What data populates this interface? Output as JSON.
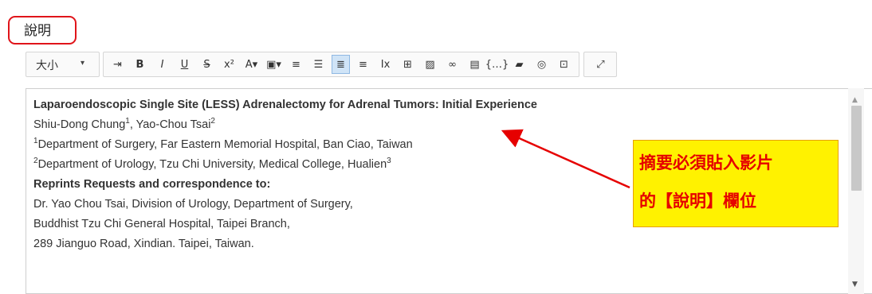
{
  "field": {
    "label": "說明"
  },
  "toolbar": {
    "size_label": "大小",
    "size_caret": "▾",
    "buttons": [
      {
        "name": "indent-icon",
        "glyph": "⇥"
      },
      {
        "name": "bold-icon",
        "glyph": "B"
      },
      {
        "name": "italic-icon",
        "glyph": "I"
      },
      {
        "name": "underline-icon",
        "glyph": "U"
      },
      {
        "name": "strikethrough-icon",
        "glyph": "S"
      },
      {
        "name": "superscript-icon",
        "glyph": "x²"
      },
      {
        "name": "font-color-icon",
        "glyph": "A▾"
      },
      {
        "name": "background-color-icon",
        "glyph": "▣▾"
      },
      {
        "name": "numbered-list-icon",
        "glyph": "≡"
      },
      {
        "name": "bulleted-list-icon",
        "glyph": "☰"
      },
      {
        "name": "align-left-icon",
        "glyph": "≣"
      },
      {
        "name": "align-center-icon",
        "glyph": "≡"
      },
      {
        "name": "remove-format-icon",
        "glyph": "Ix"
      },
      {
        "name": "table-icon",
        "glyph": "⊞"
      },
      {
        "name": "image-icon",
        "glyph": "▨"
      },
      {
        "name": "link-icon",
        "glyph": "∞"
      },
      {
        "name": "media-icon",
        "glyph": "▤"
      },
      {
        "name": "code-icon",
        "glyph": "{…}"
      },
      {
        "name": "folder-icon",
        "glyph": "▰"
      },
      {
        "name": "globe-icon",
        "glyph": "◎"
      },
      {
        "name": "source-icon",
        "glyph": "⊡"
      }
    ],
    "fullscreen_glyph": "⤢"
  },
  "editor": {
    "title": "Laparoendoscopic Single Site (LESS) Adrenalectomy for Adrenal Tumors: Initial Experience",
    "authors": {
      "name1": "Shiu-Dong Chung",
      "sup1": "1",
      "sep": ", ",
      "name2": "Yao-Chou Tsai",
      "sup2": "2"
    },
    "affiliation1": {
      "sup": "1",
      "text": "Department of Surgery, Far Eastern Memorial Hospital, Ban Ciao, Taiwan"
    },
    "affiliation2": {
      "sup": "2",
      "text": "Department of Urology, Tzu Chi University, Medical College, Hualien",
      "sup_end": "3"
    },
    "reprints_heading": "Reprints Requests and correspondence to:",
    "address_lines": [
      "Dr. Yao Chou Tsai, Division of Urology, Department of Surgery,",
      "Buddhist Tzu Chi General Hospital, Taipei Branch,",
      "289 Jianguo Road, Xindian. Taipei, Taiwan."
    ]
  },
  "scrollbar": {
    "up": "▲",
    "down": "▼"
  },
  "callout": {
    "line1": "摘要必須貼入影片",
    "line2": "的【說明】欄位"
  },
  "colors": {
    "highlight_border": "#e0141a",
    "callout_bg": "#fff200",
    "callout_text": "#e50000",
    "active_button": "#d0e4f7"
  }
}
